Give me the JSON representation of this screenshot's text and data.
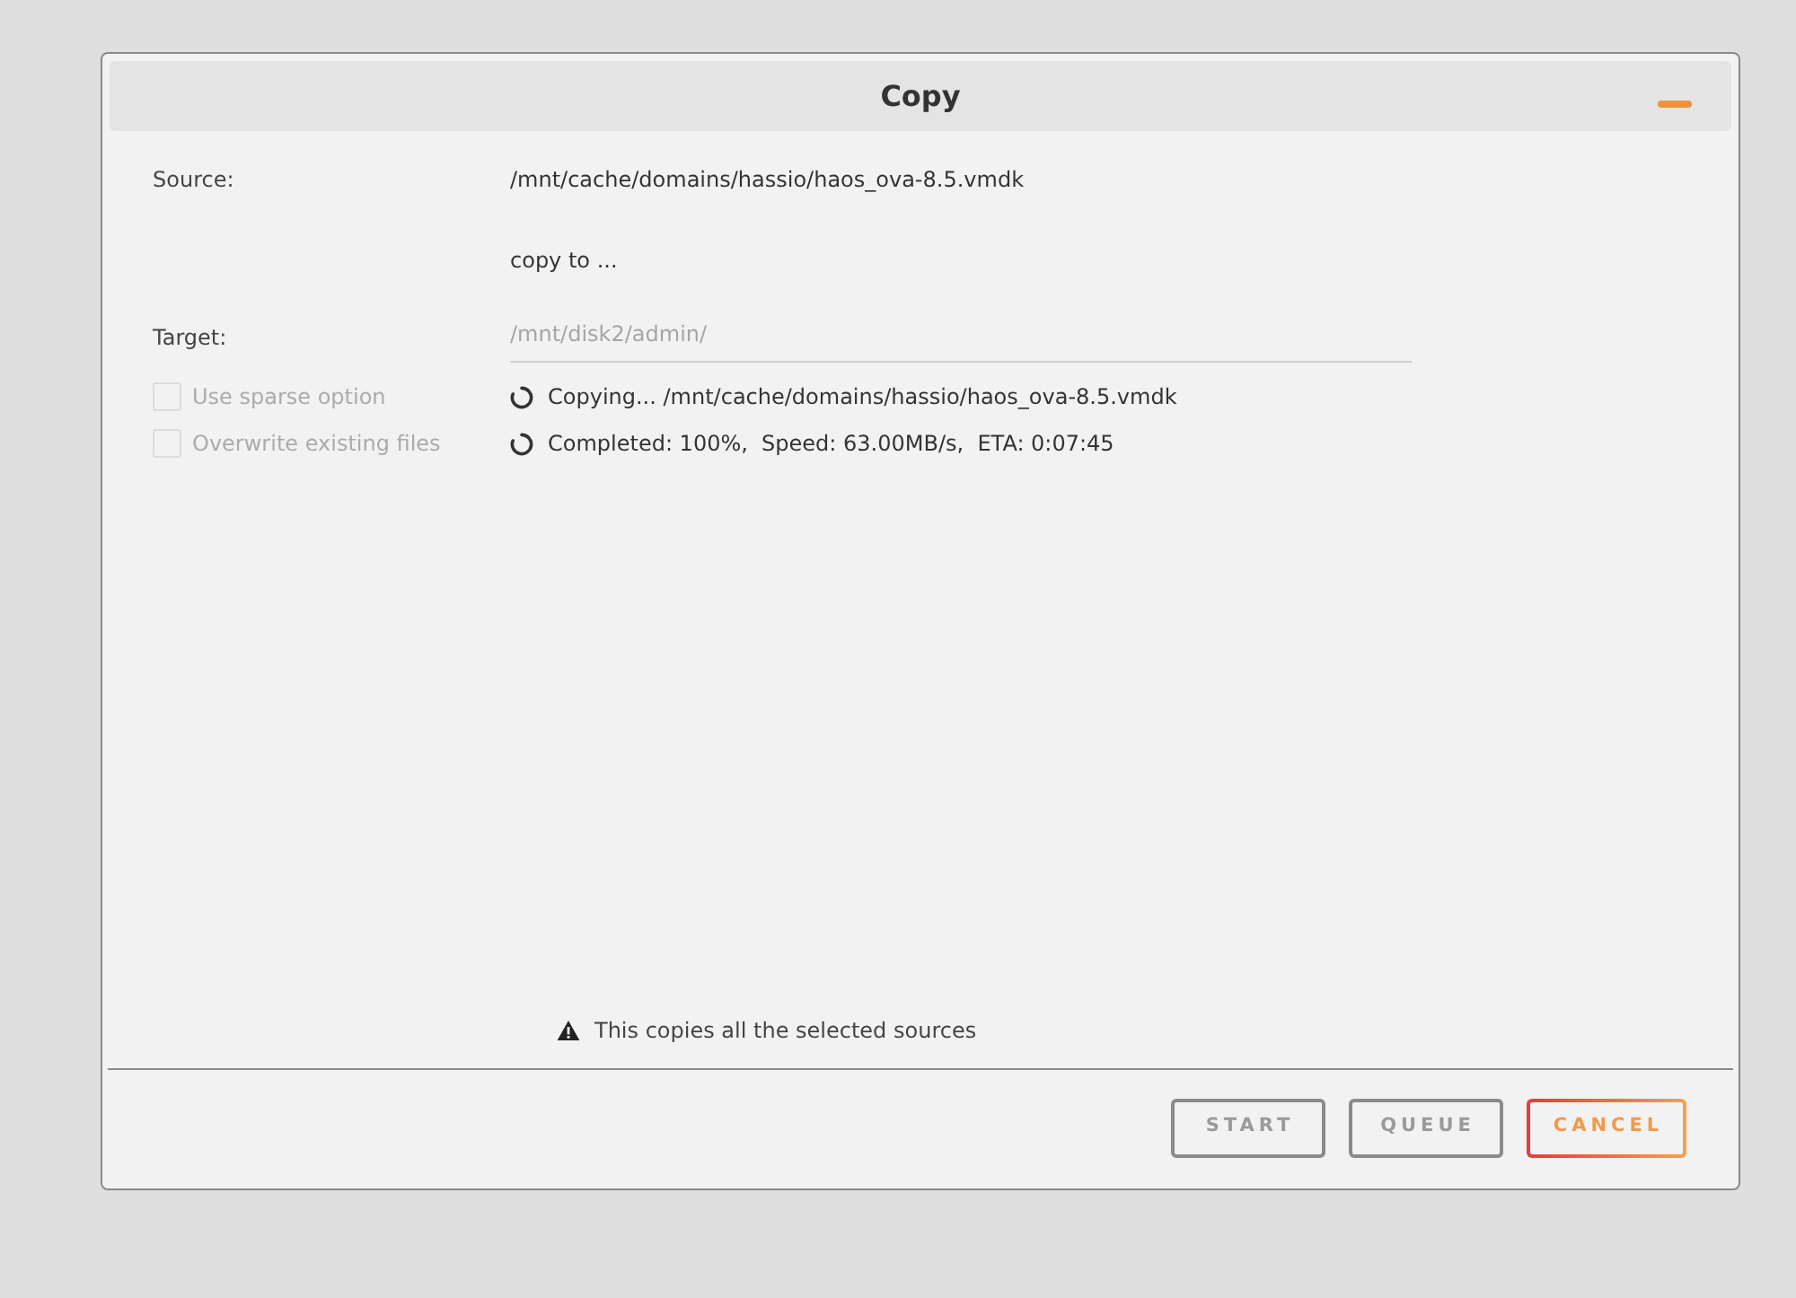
{
  "dialog": {
    "title": "Copy"
  },
  "source": {
    "label": "Source:",
    "value": "/mnt/cache/domains/hassio/haos_ova-8.5.vmdk"
  },
  "copy_to": "copy to ...",
  "target": {
    "label": "Target:",
    "value": "/mnt/disk2/admin/",
    "disabled": true
  },
  "options": [
    {
      "label": "Use sparse option",
      "checked": false,
      "disabled": true
    },
    {
      "label": "Overwrite existing files",
      "checked": false,
      "disabled": true
    }
  ],
  "progress": [
    "Copying... /mnt/cache/domains/hassio/haos_ova-8.5.vmdk",
    "Completed: 100%,  Speed: 63.00MB/s,  ETA: 0:07:45"
  ],
  "notice": "This copies all the selected sources",
  "buttons": [
    {
      "label": "START",
      "kind": "default"
    },
    {
      "label": "QUEUE",
      "kind": "default"
    },
    {
      "label": "CANCEL",
      "kind": "cancel"
    }
  ]
}
